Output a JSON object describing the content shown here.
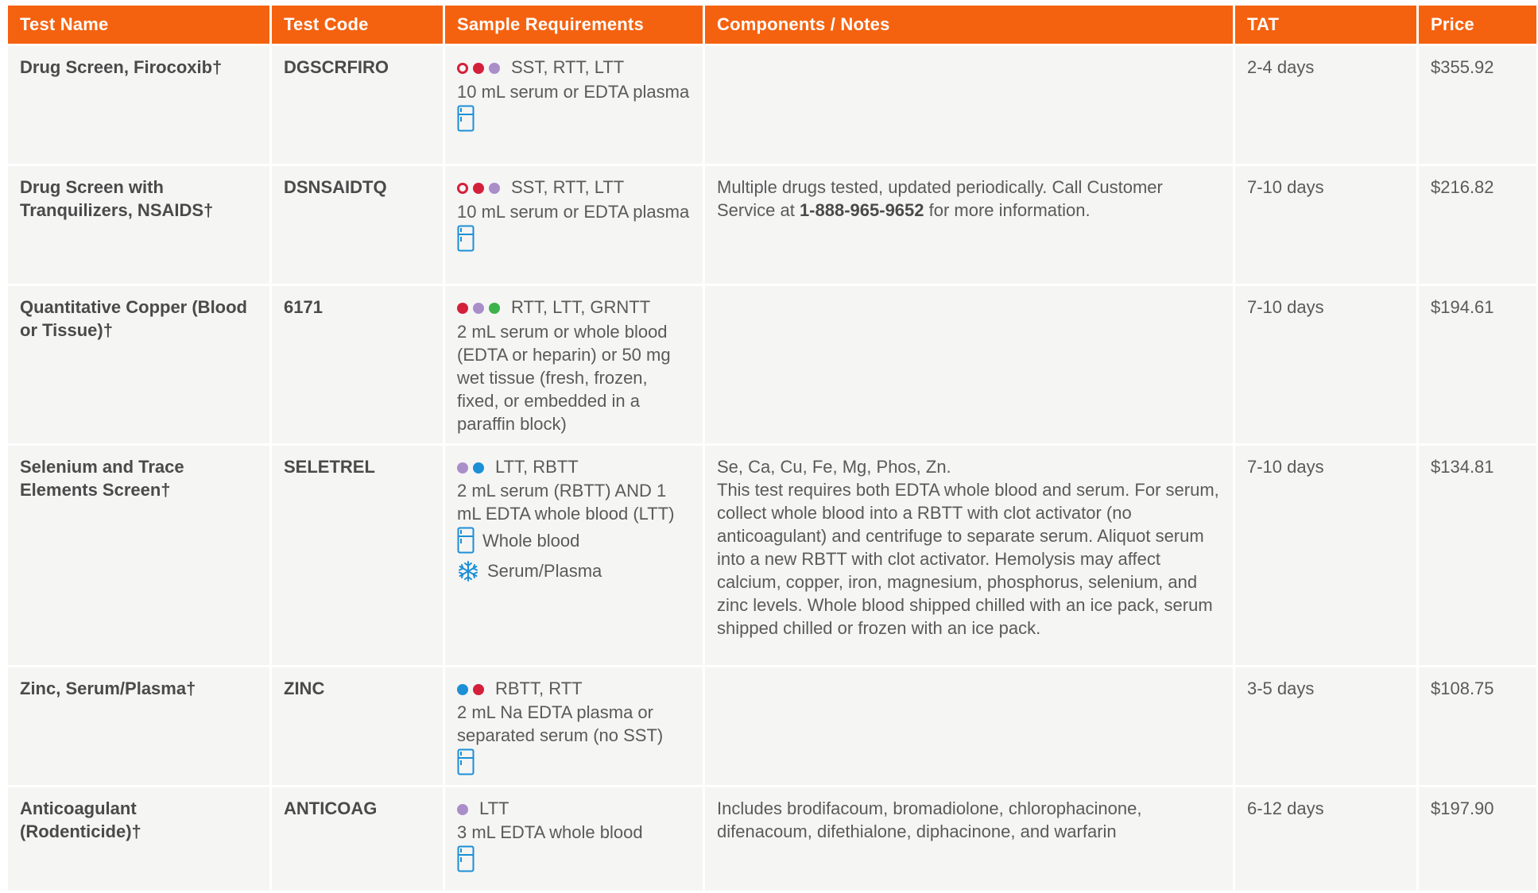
{
  "headers": {
    "name": "Test Name",
    "code": "Test Code",
    "sample": "Sample Requirements",
    "notes": "Components / Notes",
    "tat": "TAT",
    "price": "Price"
  },
  "colors": {
    "header_bg": "#f5620f",
    "row_bg": "#f5f5f4",
    "sst": "#d4203a",
    "rtt": "#d4203a",
    "ltt": "#a98ec9",
    "grntt": "#3db14a",
    "rbtt": "#1c8fd6",
    "icon_blue": "#1c8fd6"
  },
  "rows": [
    {
      "name": "Drug Screen, Firocoxib†",
      "code": "DGSCRFIRO",
      "tubes": "SST, RTT, LTT",
      "sample": "10 mL serum or EDTA plasma",
      "storage_icon": "refrigerate-icon",
      "notes": "",
      "tat": "2-4 days",
      "price": "$355.92"
    },
    {
      "name": "Drug Screen with Tranquilizers, NSAIDS†",
      "code": "DSNSAIDTQ",
      "tubes": "SST, RTT, LTT",
      "sample": "10 mL serum or EDTA plasma",
      "storage_icon": "refrigerate-icon",
      "notes_pre": "Multiple drugs tested, updated periodically. Call Customer Service at ",
      "notes_phone": "1-888-965-9652",
      "notes_post": " for more information.",
      "tat": "7-10 days",
      "price": "$216.82"
    },
    {
      "name": "Quantitative Copper (Blood or Tissue)†",
      "code": "6171",
      "tubes": "RTT, LTT, GRNTT",
      "sample": "2 mL serum or whole blood (EDTA or heparin) or 50 mg wet tissue (fresh, frozen, fixed, or embedded in a paraffin block)",
      "notes": "",
      "tat": "7-10 days",
      "price": "$194.61"
    },
    {
      "name": "Selenium and Trace Elements Screen†",
      "code": "SELETREL",
      "tubes": "LTT, RBTT",
      "sample": "2 mL serum (RBTT) AND 1 mL EDTA whole blood (LTT)",
      "storage_1": "Whole blood",
      "storage_2": "Serum/Plasma",
      "notes_line1": "Se, Ca, Cu, Fe, Mg, Phos, Zn.",
      "notes_line2": "This test requires both EDTA whole blood and serum. For serum, collect whole blood into a RBTT with clot activator (no anticoagulant) and centrifuge to separate serum. Aliquot serum into a new RBTT with clot activator. Hemolysis may affect calcium, copper, iron, magnesium, phosphorus, selenium, and zinc levels. Whole blood shipped chilled with an ice pack, serum shipped chilled or frozen with an ice pack.",
      "tat": "7-10 days",
      "price": "$134.81"
    },
    {
      "name": "Zinc, Serum/Plasma†",
      "code": "ZINC",
      "tubes": "RBTT, RTT",
      "sample": "2 mL Na EDTA plasma or separated serum (no SST)",
      "storage_icon": "refrigerate-icon",
      "notes": "",
      "tat": "3-5 days",
      "price": "$108.75"
    },
    {
      "name": "Anticoagulant (Rodenticide)†",
      "code": "ANTICOAG",
      "tubes": "LTT",
      "sample": "3 mL EDTA whole blood",
      "storage_icon": "refrigerate-icon",
      "notes": "Includes brodifacoum, bromadiolone, chlorophacinone, difenacoum, difethialone, diphacinone, and warfarin",
      "tat": "6-12 days",
      "price": "$197.90"
    }
  ]
}
